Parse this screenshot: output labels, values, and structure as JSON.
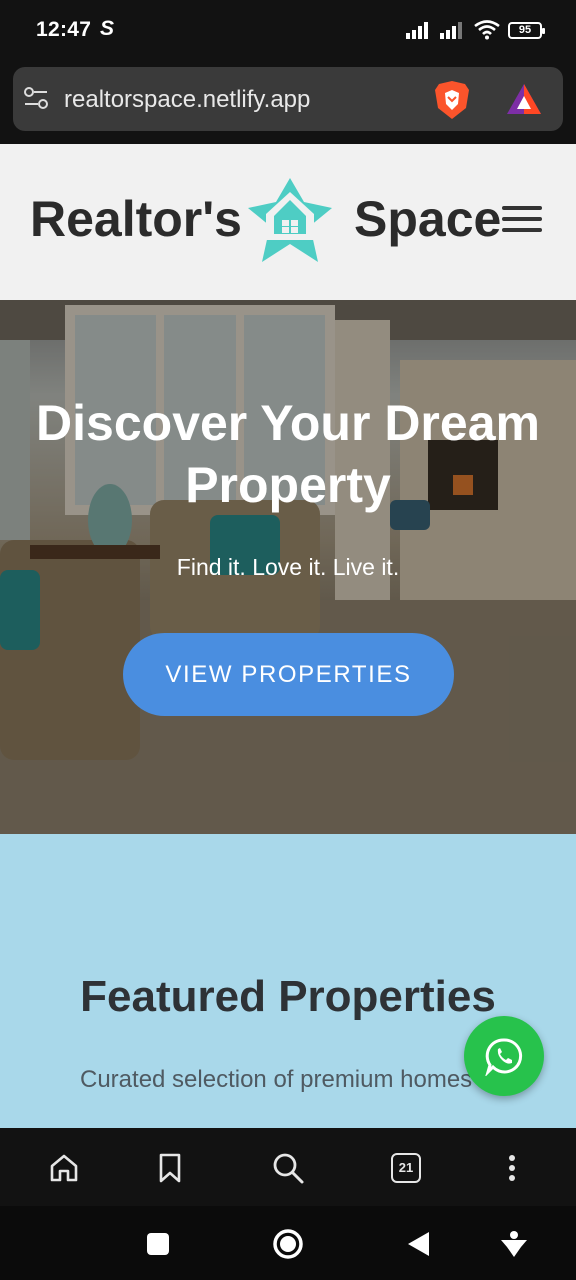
{
  "status_bar": {
    "time": "12:47",
    "app_indicator": "S",
    "battery": "95"
  },
  "browser": {
    "url": "realtorspace.netlify.app",
    "tab_count": "21"
  },
  "site": {
    "brand_left": "Realtor's",
    "brand_right": "Space",
    "hero_title": "Discover Your Dream Property",
    "hero_subtitle": "Find it. Love it. Live it.",
    "hero_cta": "VIEW PROPERTIES",
    "featured_title": "Featured Properties",
    "featured_subtitle": "Curated selection of premium homes"
  },
  "colors": {
    "logo_teal": "#4ecdc4",
    "cta_blue": "#4a8ee0",
    "featured_bg": "#a9d8ea",
    "whatsapp_green": "#27c24c"
  },
  "icons": {
    "toolbar": [
      "home-icon",
      "bookmark-icon",
      "search-icon",
      "tabs-icon",
      "more-icon"
    ],
    "system_nav": [
      "square-icon",
      "circle-home-icon",
      "back-triangle-icon",
      "accessibility-icon"
    ]
  }
}
